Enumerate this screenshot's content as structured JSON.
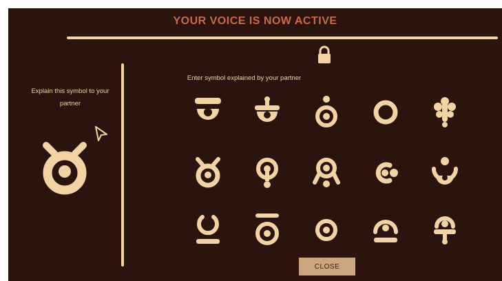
{
  "header": {
    "title": "YOUR VOICE IS NOW ACTIVE"
  },
  "panel": {
    "instruction": "Enter symbol explained by your partner",
    "left_prompt": "Explain this symbol to your partner",
    "close_label": "CLOSE"
  },
  "icons": {
    "lock": "lock-icon",
    "cursor": "mouse-cursor-icon",
    "target_symbol": "horned-ring-symbol"
  },
  "symbol_grid": [
    [
      "bar-cup-symbol",
      "pin-cup-symbol",
      "dot-ring-symbol",
      "ring-symbol",
      "tree-symbol"
    ],
    [
      "horned-ring-symbol",
      "keyhole-symbol",
      "spiked-keyhole-symbol",
      "c-dot-symbol",
      "drop-cup-symbol"
    ],
    [
      "open-ring-base-symbol",
      "bar-ring-symbol",
      "target-symbol",
      "dome-base-symbol",
      "dome-pin-symbol"
    ]
  ],
  "colors": {
    "background": "#2b140e",
    "ink": "#f3d3a4",
    "title": "#c96b4a",
    "button": "#caa57d"
  }
}
